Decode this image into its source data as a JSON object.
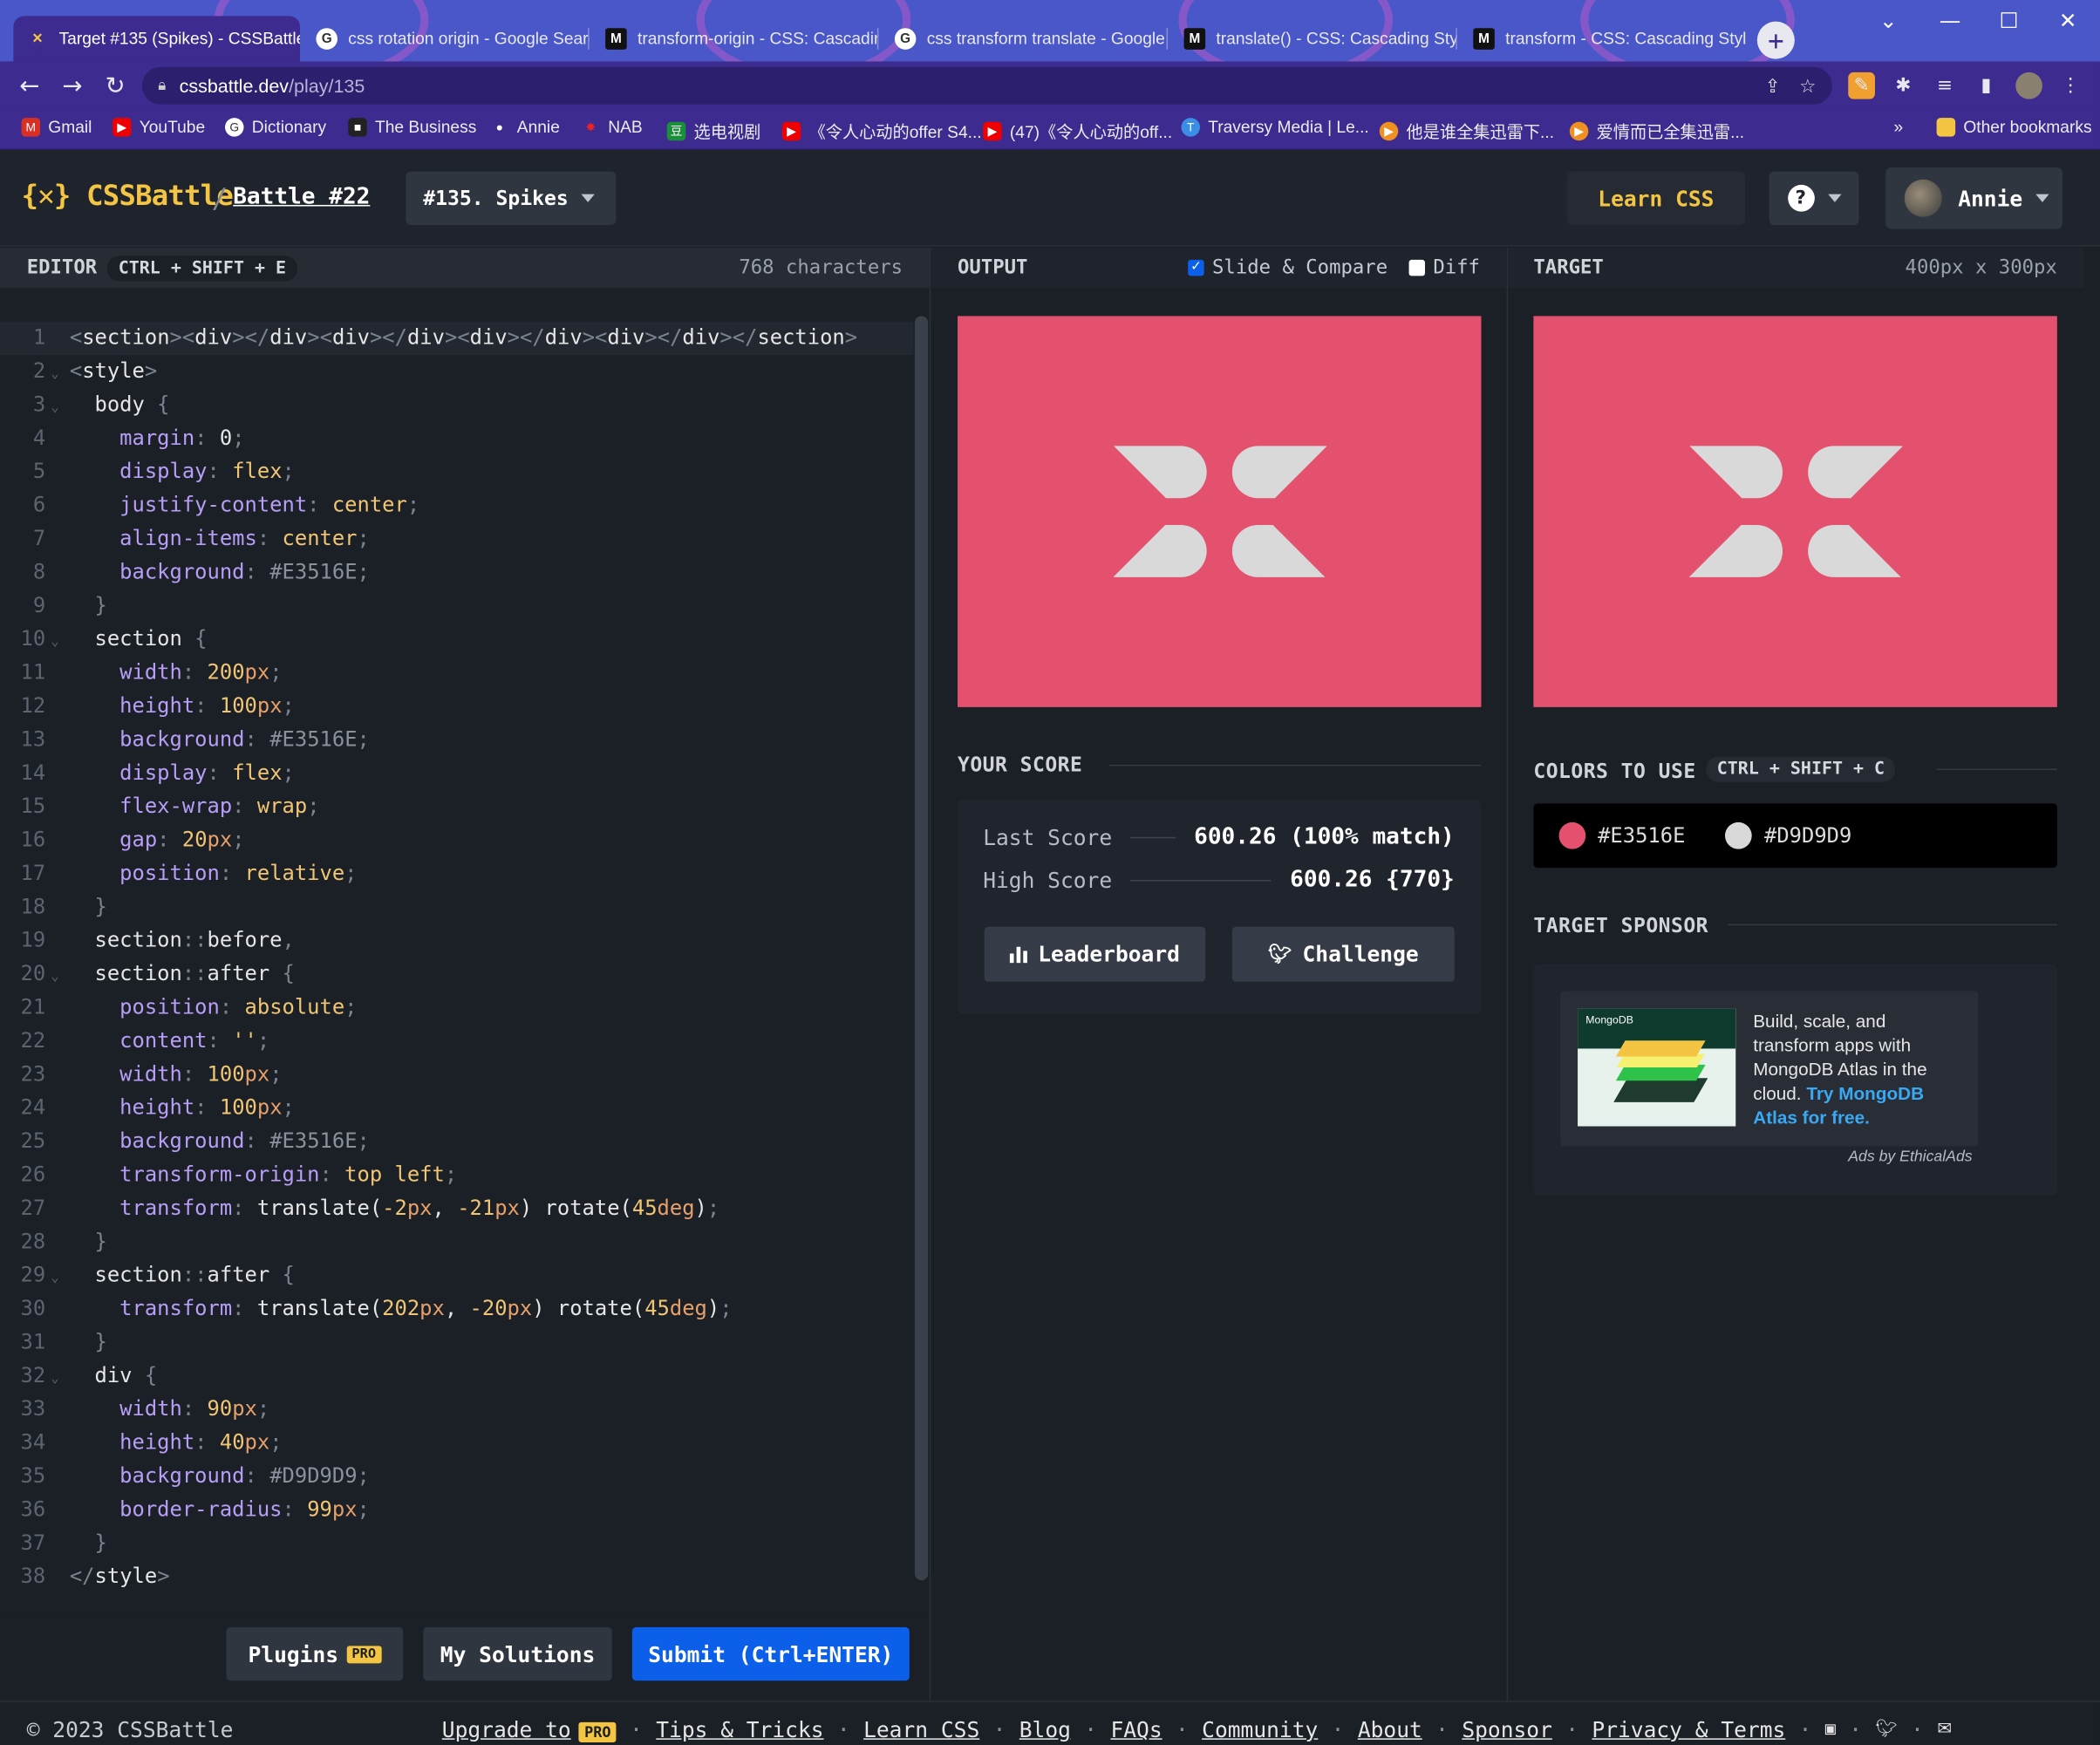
{
  "browser": {
    "tabs": [
      {
        "label": "Target #135 (Spikes) - CSSBattle",
        "icon": "cssbattle-icon",
        "active": true
      },
      {
        "label": "css rotation origin - Google Search",
        "icon": "google-icon"
      },
      {
        "label": "transform-origin - CSS: Cascading",
        "icon": "mdn-icon"
      },
      {
        "label": "css transform translate - Google",
        "icon": "google-icon"
      },
      {
        "label": "translate() - CSS: Cascading Style",
        "icon": "mdn-icon"
      },
      {
        "label": "transform - CSS: Cascading Style",
        "icon": "mdn-icon"
      }
    ],
    "url_host": "cssbattle.dev",
    "url_path": "/play/135",
    "bookmarks": [
      "Gmail",
      "YouTube",
      "Dictionary",
      "The Business",
      "Annie",
      "NAB",
      "选电视剧",
      "《令人心动的offer S4...",
      "(47)《令人心动的off...",
      "Traversy Media | Le...",
      "他是谁全集迅雷下...",
      "爱情而已全集迅雷..."
    ],
    "overflow_label": "»",
    "other_bookmarks": "Other bookmarks"
  },
  "header": {
    "logo": "{✕} CSSBattle",
    "separator": "/",
    "battle": "Battle #22",
    "target_select": "#135. Spikes",
    "learn_css": "Learn CSS",
    "help": "?",
    "user": "Annie"
  },
  "editor": {
    "title": "EDITOR",
    "shortcut": "CTRL + SHIFT + E",
    "char_count": "768 characters",
    "lines": [
      "<section><div></div><div></div><div></div><div></div></section>",
      "<style>",
      "  body {",
      "    margin: 0;",
      "    display: flex;",
      "    justify-content: center;",
      "    align-items: center;",
      "    background: #E3516E;",
      "  }",
      "  section {",
      "    width: 200px;",
      "    height: 100px;",
      "    background: #E3516E;",
      "    display: flex;",
      "    flex-wrap: wrap;",
      "    gap: 20px;",
      "    position: relative;",
      "  }",
      "  section::before,",
      "  section::after {",
      "    position: absolute;",
      "    content: '';",
      "    width: 100px;",
      "    height: 100px;",
      "    background: #E3516E;",
      "    transform-origin: top left;",
      "    transform: translate(-2px, -21px) rotate(45deg);",
      "  }",
      "  section::after {",
      "    transform: translate(202px, -20px) rotate(45deg);",
      "  }",
      "  div {",
      "    width: 90px;",
      "    height: 40px;",
      "    background: #D9D9D9;",
      "    border-radius: 99px;",
      "  }",
      "</style>"
    ],
    "plugins": "Plugins",
    "pro": "PRO",
    "my_solutions": "My Solutions",
    "submit": "Submit (Ctrl+ENTER)"
  },
  "output": {
    "title": "OUTPUT",
    "slide_compare": "Slide & Compare",
    "slide_compare_checked": true,
    "diff": "Diff",
    "diff_checked": false
  },
  "score": {
    "title": "YOUR SCORE",
    "last_label": "Last Score",
    "last_value": "600.26 (100% match)",
    "high_label": "High Score",
    "high_value": "600.26 {770}",
    "leaderboard": "Leaderboard",
    "challenge": "Challenge"
  },
  "target": {
    "title": "TARGET",
    "size": "400px x 300px",
    "colors_title": "COLORS TO USE",
    "colors_shortcut": "CTRL + SHIFT + C",
    "colors": [
      "#E3516E",
      "#D9D9D9"
    ],
    "sponsor_title": "TARGET SPONSOR",
    "ad_brand": "MongoDB",
    "ad_text": "Build, scale, and transform apps with MongoDB Atlas in the cloud.",
    "ad_link": "Try MongoDB Atlas for free.",
    "ads_by": "Ads by EthicalAds"
  },
  "footer": {
    "copyright": "© 2023 CSSBattle",
    "links": [
      "Tips & Tricks",
      "Learn CSS",
      "Blog",
      "FAQs",
      "Community",
      "About",
      "Sponsor",
      "Privacy & Terms"
    ],
    "upgrade": "Upgrade to",
    "pro": "PRO"
  },
  "colors": {
    "accent": "#f4c542",
    "primary": "#0b5fe8",
    "pink": "#E3516E",
    "gray": "#D9D9D9"
  }
}
